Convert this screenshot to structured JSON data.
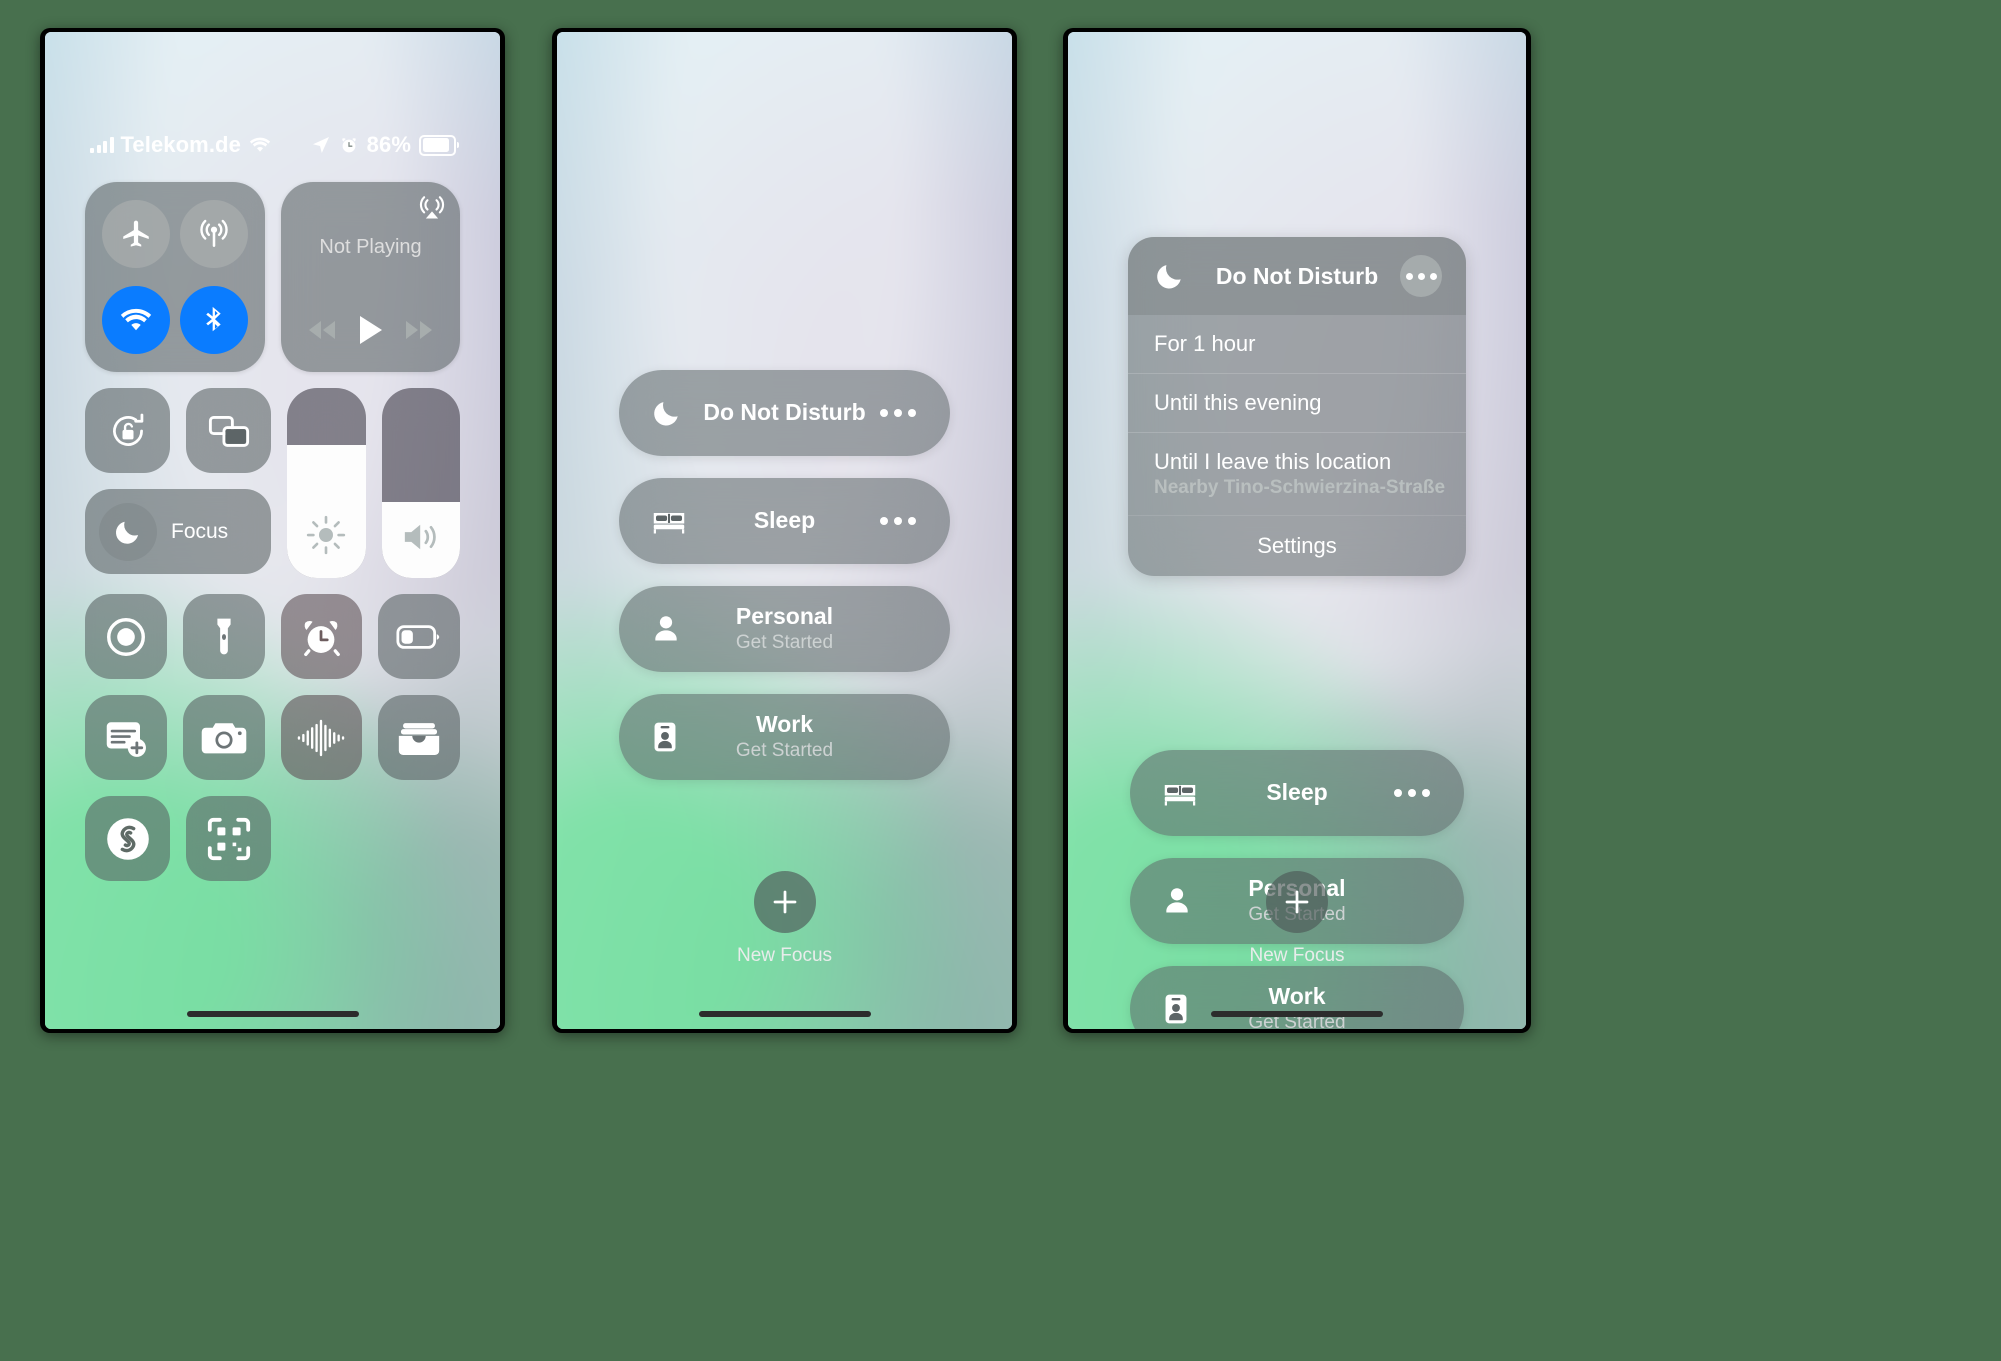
{
  "status_bar": {
    "carrier": "Telekom.de",
    "battery_percent": "86%",
    "signal_icon": "cellular-bars-icon",
    "wifi_icon": "wifi-icon",
    "location_icon": "location-arrow-icon",
    "alarm_icon": "alarm-clock-icon",
    "battery_icon": "battery-icon",
    "battery_fill": 86
  },
  "control_center": {
    "connectivity": {
      "airplane": {
        "label": "Airplane Mode",
        "icon": "airplane-icon",
        "active": false
      },
      "cellular": {
        "label": "Cellular Data",
        "icon": "cellular-antenna-icon",
        "active": false
      },
      "wifi": {
        "label": "Wi-Fi",
        "icon": "wifi-icon",
        "active": true,
        "color": "#0a7cff"
      },
      "bluetooth": {
        "label": "Bluetooth",
        "icon": "bluetooth-icon",
        "active": true,
        "color": "#0a7cff"
      }
    },
    "media": {
      "title": "Not Playing",
      "airplay_icon": "airplay-audio-icon",
      "rewind_icon": "rewind-icon",
      "play_icon": "play-icon",
      "fastforward_icon": "fast-forward-icon"
    },
    "rotation_lock": {
      "label": "Rotation Lock",
      "icon": "rotation-lock-icon"
    },
    "screen_mirroring": {
      "label": "Screen Mirroring",
      "icon": "screen-mirroring-icon"
    },
    "focus": {
      "label": "Focus",
      "icon": "moon-icon"
    },
    "brightness": {
      "label": "Brightness",
      "icon": "sun-icon",
      "value": 70
    },
    "volume": {
      "label": "Volume",
      "icon": "speaker-waves-icon",
      "value": 40
    },
    "tiles": [
      {
        "label": "Screen Recording",
        "icon": "screen-record-icon",
        "tint": false
      },
      {
        "label": "Flashlight",
        "icon": "flashlight-icon",
        "tint": false
      },
      {
        "label": "Alarm",
        "icon": "alarm-clock-icon",
        "tint": true
      },
      {
        "label": "Low Power Mode",
        "icon": "battery-low-icon",
        "tint": false
      },
      {
        "label": "Quick Note",
        "icon": "note-add-icon",
        "tint": false
      },
      {
        "label": "Camera",
        "icon": "camera-icon",
        "tint": false
      },
      {
        "label": "Voice Memos",
        "icon": "waveform-icon",
        "tint": true
      },
      {
        "label": "Wallet",
        "icon": "wallet-icon",
        "tint": false
      },
      {
        "label": "Shazam",
        "icon": "shazam-icon",
        "tint": false
      },
      {
        "label": "Code Scanner",
        "icon": "qr-code-icon",
        "tint": false
      }
    ]
  },
  "focus_panel": {
    "items": [
      {
        "title": "Do Not Disturb",
        "subtitle": "",
        "icon": "moon-icon",
        "has_more": true
      },
      {
        "title": "Sleep",
        "subtitle": "",
        "icon": "bed-icon",
        "has_more": true
      },
      {
        "title": "Personal",
        "subtitle": "Get Started",
        "icon": "person-icon",
        "has_more": false
      },
      {
        "title": "Work",
        "subtitle": "Get Started",
        "icon": "id-badge-icon",
        "has_more": false
      }
    ],
    "new_focus": {
      "label": "New Focus",
      "icon": "plus-icon"
    }
  },
  "dnd_expanded": {
    "header": {
      "title": "Do Not Disturb",
      "icon": "moon-icon",
      "more_icon": "ellipsis-icon"
    },
    "options": [
      {
        "label": "For 1 hour",
        "detail": ""
      },
      {
        "label": "Until this evening",
        "detail": ""
      },
      {
        "label": "Until I leave this location",
        "detail": "Nearby Tino-Schwierzina-Straße"
      }
    ],
    "settings_label": "Settings",
    "remaining_items": [
      {
        "title": "Sleep",
        "subtitle": "",
        "icon": "bed-icon",
        "has_more": true
      },
      {
        "title": "Personal",
        "subtitle": "Get Started",
        "icon": "person-icon",
        "has_more": false
      },
      {
        "title": "Work",
        "subtitle": "Get Started",
        "icon": "id-badge-icon",
        "has_more": false
      }
    ],
    "new_focus": {
      "label": "New Focus",
      "icon": "plus-icon"
    }
  },
  "colors": {
    "page_background": "#48704e",
    "accent_blue": "#0a7cff",
    "module_fill": "rgba(88,96,98,0.58)"
  }
}
